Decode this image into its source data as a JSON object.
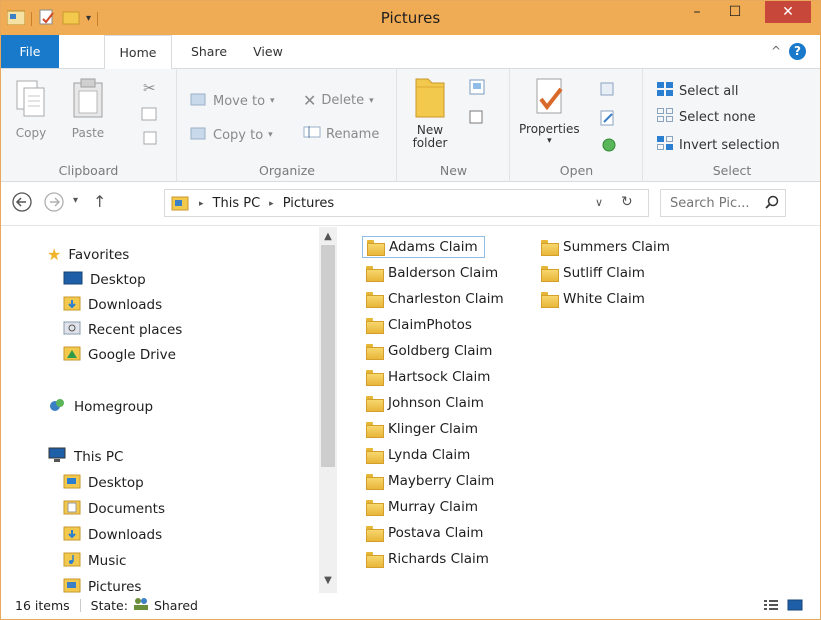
{
  "window": {
    "title": "Pictures",
    "minimize": "–",
    "maximize": "☐",
    "close": "✕"
  },
  "tabs": [
    "File",
    "Home",
    "Share",
    "View"
  ],
  "ribbon": {
    "clipboard": {
      "label": "Clipboard",
      "copy": "Copy",
      "paste": "Paste"
    },
    "organize": {
      "label": "Organize",
      "move_to": "Move to",
      "copy_to": "Copy to",
      "delete": "Delete",
      "rename": "Rename"
    },
    "new": {
      "label": "New",
      "new_folder_line1": "New",
      "new_folder_line2": "folder"
    },
    "open": {
      "label": "Open",
      "properties": "Properties"
    },
    "select": {
      "label": "Select",
      "select_all": "Select all",
      "select_none": "Select none",
      "invert_selection": "Invert selection"
    }
  },
  "address": {
    "crumbs": [
      "This PC",
      "Pictures"
    ],
    "search_placeholder": "Search Pic..."
  },
  "navpane": {
    "favorites": {
      "label": "Favorites",
      "items": [
        "Desktop",
        "Downloads",
        "Recent places",
        "Google Drive"
      ]
    },
    "homegroup": "Homegroup",
    "this_pc": {
      "label": "This PC",
      "items": [
        "Desktop",
        "Documents",
        "Downloads",
        "Music",
        "Pictures"
      ]
    }
  },
  "files": {
    "column1": [
      "Adams Claim",
      "Balderson Claim",
      "Charleston Claim",
      "ClaimPhotos",
      "Goldberg Claim",
      "Hartsock Claim",
      "Johnson Claim",
      "Klinger Claim",
      "Lynda Claim",
      "Mayberry Claim",
      "Murray Claim",
      "Postava Claim",
      "Richards Claim"
    ],
    "column2": [
      "Summers Claim",
      "Sutliff Claim",
      "White Claim"
    ],
    "selected": "Adams Claim"
  },
  "status": {
    "items": "16 items",
    "state_label": "State:",
    "state_value": "Shared"
  },
  "colors": {
    "titlebar": "#f0ac55",
    "file_tab": "#1979ca",
    "close_button": "#c7473b",
    "folder": "#e8b63a",
    "selection_border": "#8fbde8"
  }
}
